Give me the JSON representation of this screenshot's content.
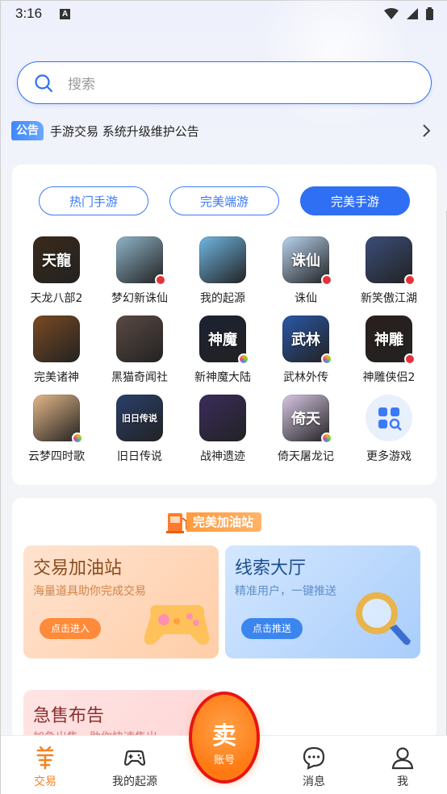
{
  "status_bar": {
    "time": "3:16",
    "a_icon": "A"
  },
  "search": {
    "placeholder": "搜索"
  },
  "notice": {
    "badge": "公告",
    "text": "手游交易 系统升级维护公告"
  },
  "tabs": [
    "热门手游",
    "完美端游",
    "完美手游"
  ],
  "active_tab": 2,
  "games": [
    {
      "name": "天龙八部2",
      "color": "#3b2a1a",
      "glyph": "天龍",
      "badge": "none"
    },
    {
      "name": "梦幻新诛仙",
      "color": "#8fb4c8",
      "glyph": "",
      "badge": "red"
    },
    {
      "name": "我的起源",
      "color": "#6fb7e3",
      "glyph": "",
      "badge": "none"
    },
    {
      "name": "诛仙",
      "color": "#b9d4ef",
      "glyph": "诛仙",
      "badge": "red"
    },
    {
      "name": "新笑傲江湖",
      "color": "#3b4e7a",
      "glyph": "",
      "badge": "red"
    },
    {
      "name": "完美诸神",
      "color": "#7a4a22",
      "glyph": "",
      "badge": "none"
    },
    {
      "name": "黑猫奇闻社",
      "color": "#5a4a44",
      "glyph": "",
      "badge": "none"
    },
    {
      "name": "新神魔大陆",
      "color": "#1c2233",
      "glyph": "神魔",
      "badge": "flower"
    },
    {
      "name": "武林外传",
      "color": "#2a58a8",
      "glyph": "武林",
      "badge": "flower"
    },
    {
      "name": "神雕侠侣2",
      "color": "#2a1f1c",
      "glyph": "神雕",
      "badge": "red"
    },
    {
      "name": "云梦四时歌",
      "color": "#e6b889",
      "glyph": "",
      "badge": "flower"
    },
    {
      "name": "旧日传说",
      "color": "#29406b",
      "glyph": "旧日传说",
      "badge": "none"
    },
    {
      "name": "战神遗迹",
      "color": "#3b2c5c",
      "glyph": "",
      "badge": "none"
    },
    {
      "name": "倚天屠龙记",
      "color": "#d9c8e6",
      "glyph": "倚天",
      "badge": "flower"
    },
    {
      "name": "更多游戏",
      "color": "#e8f0fc",
      "glyph": "",
      "badge": "more"
    }
  ],
  "station": {
    "label": "完美加油站"
  },
  "promo_left": {
    "title": "交易加油站",
    "sub": "海量道具助你完成交易",
    "button": "点击进入"
  },
  "promo_right": {
    "title": "线索大厅",
    "sub": "精准用户，一键推送",
    "button": "点击推送"
  },
  "urgent": {
    "title": "急售布告",
    "sub": "加急出售，助你快速售出"
  },
  "tabbar": {
    "trade": "交易",
    "origin": "我的起源",
    "messages": "消息",
    "me": "我"
  },
  "sell": {
    "main": "卖",
    "sub": "账号"
  },
  "colors": {
    "accent": "#2f6ff3",
    "orange": "#f08421",
    "highlight_ring": "#e81414"
  }
}
